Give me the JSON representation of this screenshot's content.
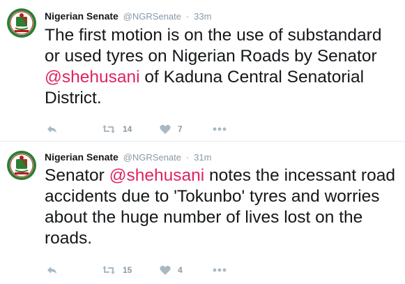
{
  "tweets": [
    {
      "author_name": "Nigerian Senate",
      "handle": "@NGRSenate",
      "separator": "·",
      "time": "33m",
      "text_before": "The first motion is on the use of substandard or used tyres on Nigerian Roads by Senator ",
      "mention": "@shehusani",
      "text_after": " of Kaduna Central Senatorial District.",
      "retweets": "14",
      "likes": "7"
    },
    {
      "author_name": "Nigerian Senate",
      "handle": "@NGRSenate",
      "separator": "·",
      "time": "31m",
      "text_before": "Senator ",
      "mention": "@shehusani",
      "text_after": " notes the incessant road accidents due to 'Tokunbo' tyres and worries about the huge number of lives lost on the roads.",
      "retweets": "15",
      "likes": "4"
    }
  ],
  "colors": {
    "mention": "#e0245e",
    "muted": "#8899a6",
    "text": "#14171a",
    "avatar_green": "#2e7d32",
    "avatar_red": "#b71c1c"
  },
  "icons": {
    "avatar": "senate-seal-icon",
    "reply": "reply-icon",
    "retweet": "retweet-icon",
    "like": "heart-icon",
    "more": "more-dots-icon"
  }
}
